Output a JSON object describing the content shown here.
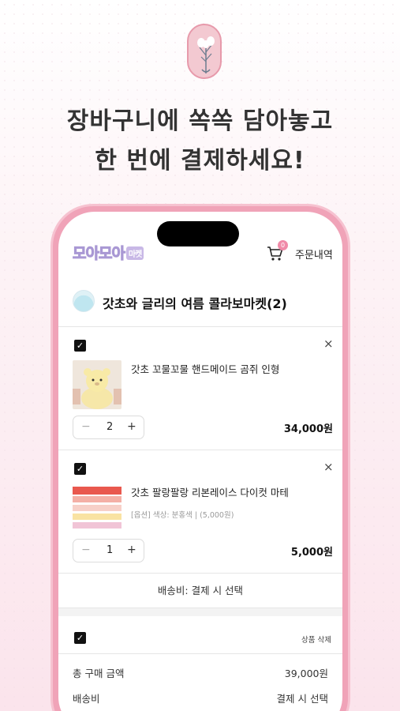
{
  "headline": {
    "line1": "장바구니에 쏙쏙 담아놓고",
    "line2": "한 번에 결제하세요!"
  },
  "app": {
    "logo_text": "모아모아",
    "logo_sub": "마켓",
    "cart_icon": "cart-icon",
    "cart_count": "0",
    "orders_label": "주문내역"
  },
  "store": {
    "name": "갓초와 글리의 여름 콜라보마켓(2)"
  },
  "items": [
    {
      "name": "갓초 꼬물꼬물 핸드메이드 곰쥐 인형",
      "option": "",
      "qty": "2",
      "price": "34,000원",
      "minus": "−",
      "plus": "+",
      "remove": "×"
    },
    {
      "name": "갓초 팔랑팔랑 리본레이스 다이컷 마테",
      "option": "[옵션] 색상: 분홍색 | (5,000원)",
      "qty": "1",
      "price": "5,000원",
      "minus": "−",
      "plus": "+",
      "remove": "×"
    }
  ],
  "shipping_label": "배송비: 결제 시 선택",
  "summary": {
    "delete_label": "상품 삭제",
    "total_label": "총 구매 금액",
    "total_value": "39,000원",
    "shipping_label": "배송비",
    "shipping_value": "결제 시 선택"
  },
  "colors": {
    "accent": "#f08aa8",
    "phone_frame": "#f0a3b8",
    "logo": "#c8b8e6"
  }
}
